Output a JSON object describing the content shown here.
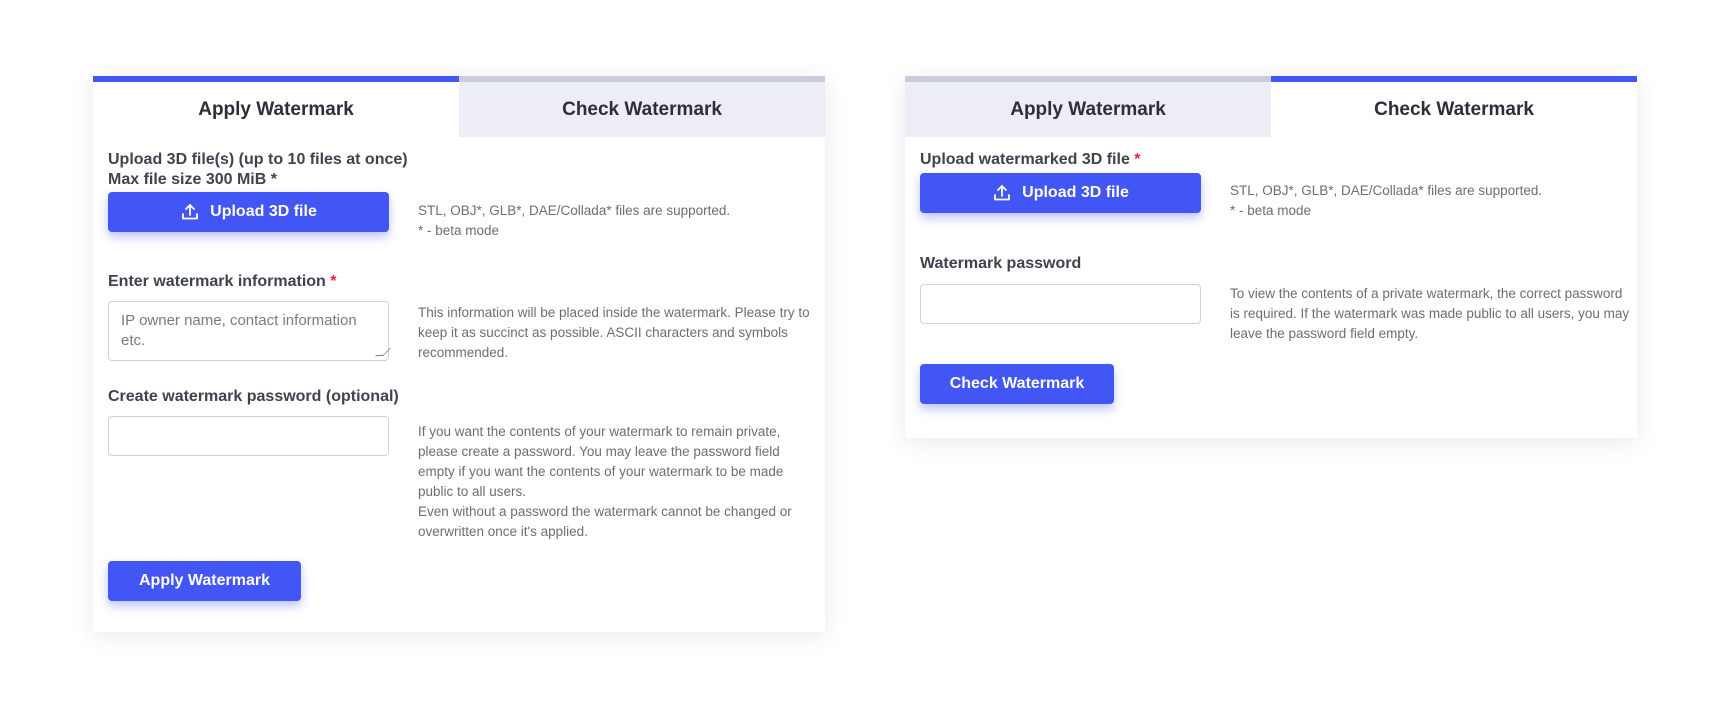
{
  "apply_card": {
    "tabs": [
      {
        "label": "Apply Watermark",
        "active": true
      },
      {
        "label": "Check Watermark",
        "active": false
      }
    ],
    "upload": {
      "label_line1": "Upload 3D file(s) (up to 10 files at once)",
      "label_line2": "Max file size 300 MiB *",
      "button_label": "Upload 3D file",
      "help_line1": "STL, OBJ*, GLB*, DAE/Collada* files are supported.",
      "help_line2": "* - beta mode"
    },
    "watermark_info": {
      "label": "Enter watermark information",
      "required_mark": "*",
      "placeholder": "IP owner name, contact information etc.",
      "value": "",
      "help": "This information will be placed inside the watermark. Please try to keep it as succinct as possible. ASCII characters and symbols recommended."
    },
    "password": {
      "label": "Create watermark password (optional)",
      "value": "",
      "help_line1": "If you want the contents of your watermark to remain private, please create a password. You may leave the password field empty if you want the contents of your watermark to be made public to all users.",
      "help_line2": "Even without a password the watermark cannot be changed or overwritten once it's applied."
    },
    "submit_label": "Apply Watermark"
  },
  "check_card": {
    "tabs": [
      {
        "label": "Apply Watermark",
        "active": false
      },
      {
        "label": "Check Watermark",
        "active": true
      }
    ],
    "upload": {
      "label": "Upload watermarked 3D file",
      "required_mark": "*",
      "button_label": "Upload 3D file",
      "help_line1": "STL, OBJ*, GLB*, DAE/Collada* files are supported.",
      "help_line2": "* - beta mode"
    },
    "password": {
      "label": "Watermark password",
      "value": "",
      "help": "To view the contents of a private watermark, the correct password is required. If the watermark was made public to all users, you may leave the password field empty."
    },
    "submit_label": "Check Watermark"
  },
  "colors": {
    "accent": "#4256f5",
    "required": "#e0243a",
    "inactive_tab_bg": "#ecedf5",
    "inactive_tab_border": "#c9ccdc"
  },
  "icons": {
    "upload": "upload-icon"
  }
}
